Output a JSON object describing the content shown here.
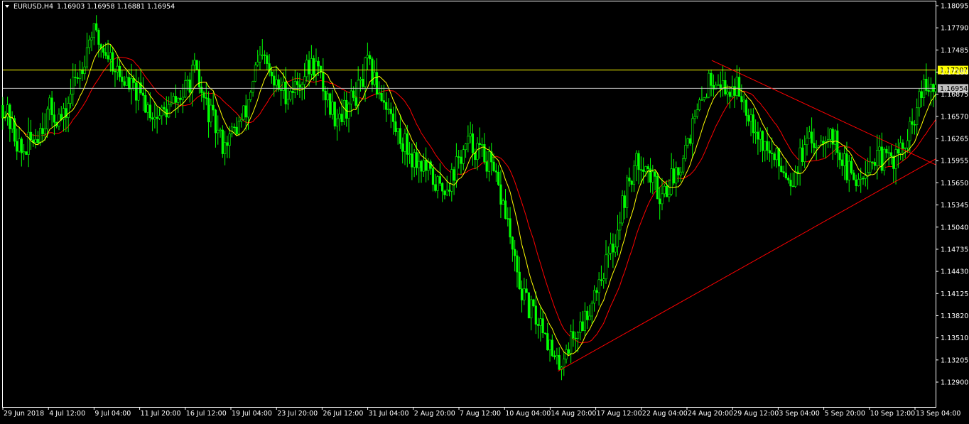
{
  "header": {
    "symbol": "EURUSD,H4",
    "ohlc": "1.16903 1.16958 1.16881 1.16954",
    "menu_icon": "dropdown-triangle-icon"
  },
  "colors": {
    "background": "#000000",
    "candles": "#00FF00",
    "ma_fast": "#FFFF00",
    "ma_slow": "#FF0000",
    "trendline": "#FF0000",
    "resistance": "#FFFF00",
    "bid_line": "#C0C0C0",
    "axis_text": "#FFFFFF"
  },
  "chart_data": {
    "type": "candlestick",
    "symbol": "EURUSD",
    "timeframe": "H4",
    "y_ticks": [
      "1.18095",
      "1.17790",
      "1.17485",
      "1.17180",
      "1.16875",
      "1.16570",
      "1.16265",
      "1.15955",
      "1.15650",
      "1.15345",
      "1.15040",
      "1.14735",
      "1.14430",
      "1.14125",
      "1.13820",
      "1.13510",
      "1.13205",
      "1.12900"
    ],
    "ylim": [
      1.129,
      1.18095
    ],
    "x_ticks": [
      "29 Jun 2018",
      "4 Jul 12:00",
      "9 Jul 04:00",
      "11 Jul 20:00",
      "16 Jul 12:00",
      "19 Jul 04:00",
      "23 Jul 20:00",
      "26 Jul 12:00",
      "31 Jul 04:00",
      "2 Aug 20:00",
      "7 Aug 12:00",
      "10 Aug 04:00",
      "14 Aug 20:00",
      "17 Aug 12:00",
      "22 Aug 04:00",
      "24 Aug 20:00",
      "29 Aug 12:00",
      "3 Sep 04:00",
      "5 Sep 20:00",
      "10 Sep 12:00",
      "13 Sep 04:00"
    ],
    "price_path": [
      [
        0,
        1.1672
      ],
      [
        0.01,
        1.164
      ],
      [
        0.02,
        1.1605
      ],
      [
        0.035,
        1.163
      ],
      [
        0.05,
        1.1665
      ],
      [
        0.065,
        1.165
      ],
      [
        0.075,
        1.17
      ],
      [
        0.085,
        1.173
      ],
      [
        0.095,
        1.1775
      ],
      [
        0.105,
        1.1755
      ],
      [
        0.115,
        1.174
      ],
      [
        0.125,
        1.1712
      ],
      [
        0.135,
        1.17
      ],
      [
        0.15,
        1.168
      ],
      [
        0.165,
        1.1655
      ],
      [
        0.18,
        1.167
      ],
      [
        0.195,
        1.169
      ],
      [
        0.205,
        1.172
      ],
      [
        0.215,
        1.168
      ],
      [
        0.225,
        1.165
      ],
      [
        0.235,
        1.162
      ],
      [
        0.245,
        1.163
      ],
      [
        0.26,
        1.166
      ],
      [
        0.27,
        1.172
      ],
      [
        0.28,
        1.1735
      ],
      [
        0.29,
        1.17
      ],
      [
        0.305,
        1.169
      ],
      [
        0.315,
        1.17
      ],
      [
        0.325,
        1.172
      ],
      [
        0.335,
        1.173
      ],
      [
        0.345,
        1.169
      ],
      [
        0.355,
        1.166
      ],
      [
        0.365,
        1.1665
      ],
      [
        0.375,
        1.168
      ],
      [
        0.385,
        1.17
      ],
      [
        0.39,
        1.173
      ],
      [
        0.4,
        1.17
      ],
      [
        0.41,
        1.168
      ],
      [
        0.42,
        1.164
      ],
      [
        0.43,
        1.162
      ],
      [
        0.44,
        1.16
      ],
      [
        0.45,
        1.159
      ],
      [
        0.46,
        1.157
      ],
      [
        0.47,
        1.1555
      ],
      [
        0.48,
        1.157
      ],
      [
        0.49,
        1.16
      ],
      [
        0.5,
        1.162
      ],
      [
        0.51,
        1.161
      ],
      [
        0.52,
        1.1595
      ],
      [
        0.53,
        1.156
      ],
      [
        0.54,
        1.152
      ],
      [
        0.55,
        1.144
      ],
      [
        0.56,
        1.14
      ],
      [
        0.57,
        1.138
      ],
      [
        0.58,
        1.137
      ],
      [
        0.59,
        1.132
      ],
      [
        0.595,
        1.131
      ],
      [
        0.605,
        1.134
      ],
      [
        0.615,
        1.136
      ],
      [
        0.625,
        1.138
      ],
      [
        0.635,
        1.142
      ],
      [
        0.645,
        1.145
      ],
      [
        0.655,
        1.148
      ],
      [
        0.665,
        1.154
      ],
      [
        0.675,
        1.158
      ],
      [
        0.685,
        1.16
      ],
      [
        0.695,
        1.157
      ],
      [
        0.705,
        1.155
      ],
      [
        0.715,
        1.1565
      ],
      [
        0.725,
        1.159
      ],
      [
        0.735,
        1.163
      ],
      [
        0.745,
        1.166
      ],
      [
        0.755,
        1.17
      ],
      [
        0.765,
        1.1715
      ],
      [
        0.775,
        1.169
      ],
      [
        0.785,
        1.17
      ],
      [
        0.795,
        1.168
      ],
      [
        0.805,
        1.165
      ],
      [
        0.815,
        1.162
      ],
      [
        0.825,
        1.16
      ],
      [
        0.835,
        1.159
      ],
      [
        0.845,
        1.157
      ],
      [
        0.855,
        1.16
      ],
      [
        0.865,
        1.162
      ],
      [
        0.875,
        1.1625
      ],
      [
        0.885,
        1.164
      ],
      [
        0.895,
        1.1615
      ],
      [
        0.905,
        1.158
      ],
      [
        0.915,
        1.157
      ],
      [
        0.925,
        1.159
      ],
      [
        0.935,
        1.16
      ],
      [
        0.945,
        1.1595
      ],
      [
        0.955,
        1.16
      ],
      [
        0.965,
        1.161
      ],
      [
        0.975,
        1.164
      ],
      [
        0.985,
        1.169
      ],
      [
        1.0,
        1.1695
      ]
    ],
    "horizontal_lines": [
      {
        "label": "1.17207",
        "price": 1.17207,
        "color": "#FFFF00",
        "kind": "resistance"
      },
      {
        "label": "1.16954",
        "price": 1.16954,
        "color": "#C0C0C0",
        "kind": "bid"
      }
    ],
    "trendlines": [
      {
        "from": [
          0.595,
          1.1305
        ],
        "to": [
          1.0,
          1.1598
        ],
        "color": "#FF0000"
      },
      {
        "from": [
          0.76,
          1.1734
        ],
        "to": [
          1.0,
          1.159
        ],
        "color": "#FF0000"
      }
    ]
  }
}
